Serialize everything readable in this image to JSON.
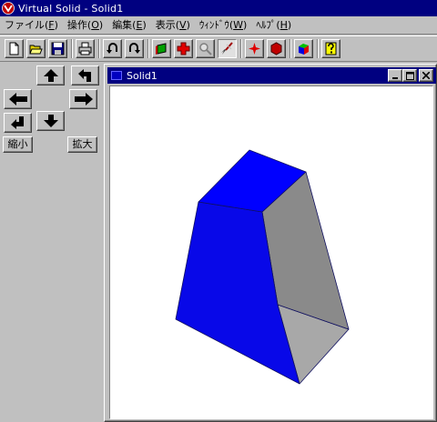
{
  "window": {
    "title": "Virtual Solid - Solid1"
  },
  "menu": [
    {
      "name": "menu-file",
      "label": "ファイル(",
      "acc": "F",
      "end": ")"
    },
    {
      "name": "menu-operation",
      "label": "操作(",
      "acc": "O",
      "end": ")"
    },
    {
      "name": "menu-edit",
      "label": "編集(",
      "acc": "E",
      "end": ")"
    },
    {
      "name": "menu-view",
      "label": "表示(",
      "acc": "V",
      "end": ")"
    },
    {
      "name": "menu-window",
      "label": "ｳｨﾝﾄﾞｳ(",
      "acc": "W",
      "end": ")"
    },
    {
      "name": "menu-help",
      "label": "ﾍﾙﾌﾟ(",
      "acc": "H",
      "end": ")"
    }
  ],
  "toolbar": {
    "icons": [
      "new-document-icon",
      "open-folder-icon",
      "save-icon",
      "print-icon",
      "undo-icon",
      "redo-icon",
      "green-solid-icon",
      "red-cross-icon",
      "magnifier-icon",
      "brush-icon",
      "red-star-icon",
      "red-hexagon-icon",
      "color-cube-icon",
      "help-icon"
    ]
  },
  "nav": {
    "zoom_out_label": "縮小",
    "zoom_in_label": "拡大"
  },
  "child": {
    "title": "Solid1",
    "minimize": "_",
    "maximize": "□",
    "close": "✕"
  },
  "colors": {
    "title_bar": "#000080",
    "face_gray": "#c0c0c0",
    "solid_blue": "#0000ff",
    "solid_front_blue": "#0808e8",
    "solid_right_gray": "#8a8a8a",
    "solid_bottom_gray": "#a8a8a8"
  }
}
